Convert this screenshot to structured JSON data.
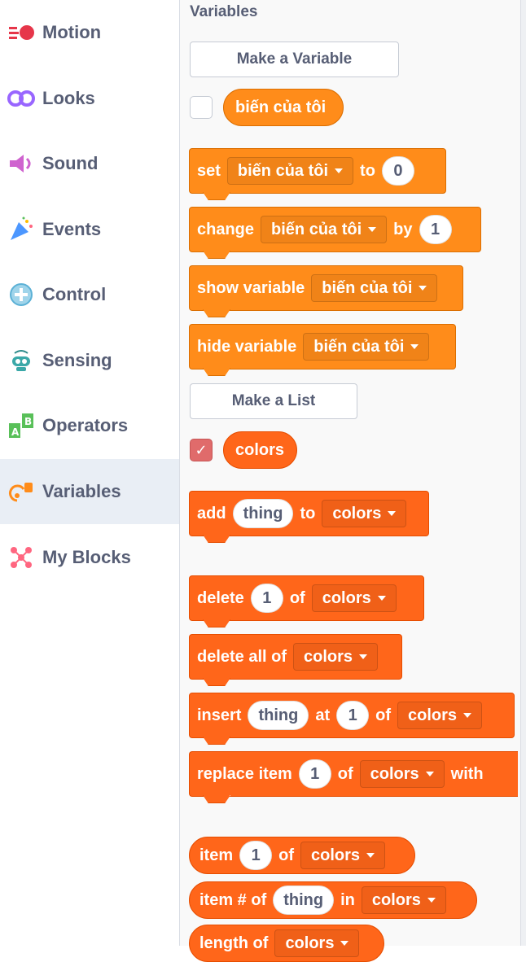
{
  "categories": [
    {
      "label": "Motion",
      "icon": "motion-icon",
      "color": "#e6364a"
    },
    {
      "label": "Looks",
      "icon": "looks-icon",
      "color": "#9966ff"
    },
    {
      "label": "Sound",
      "icon": "sound-icon",
      "color": "#cf63cf"
    },
    {
      "label": "Events",
      "icon": "events-icon",
      "color": "#ffbf00"
    },
    {
      "label": "Control",
      "icon": "control-icon",
      "color": "#ffab19"
    },
    {
      "label": "Sensing",
      "icon": "sensing-icon",
      "color": "#5cb1d6"
    },
    {
      "label": "Operators",
      "icon": "operators-icon",
      "color": "#59c059"
    },
    {
      "label": "Variables",
      "icon": "variables-icon",
      "color": "#ff8c1a"
    },
    {
      "label": "My Blocks",
      "icon": "myblocks-icon",
      "color": "#ff6680"
    }
  ],
  "selected_category": "Variables",
  "palette": {
    "section_title": "Variables",
    "make_variable": "Make a Variable",
    "variable_name": "biến của tôi",
    "set_block": {
      "a": "set",
      "b": "to",
      "value": "0"
    },
    "change_block": {
      "a": "change",
      "b": "by",
      "value": "1"
    },
    "show_variable": "show variable",
    "hide_variable": "hide variable",
    "make_list": "Make a List",
    "list_name": "colors",
    "add_block": {
      "a": "add",
      "item": "thing",
      "b": "to"
    },
    "delete_block": {
      "a": "delete",
      "index": "1",
      "b": "of"
    },
    "delete_all": "delete all of",
    "insert_block": {
      "a": "insert",
      "item": "thing",
      "b": "at",
      "index": "1",
      "c": "of"
    },
    "replace_block": {
      "a": "replace item",
      "index": "1",
      "b": "of",
      "c": "with"
    },
    "item_block": {
      "a": "item",
      "index": "1",
      "b": "of"
    },
    "item_num_block": {
      "a": "item # of",
      "item": "thing",
      "b": "in"
    },
    "length_block": {
      "a": "length of"
    }
  },
  "colors": {
    "variables": "#ff8c1a",
    "lists": "#ff661a",
    "text": "#575e75"
  }
}
